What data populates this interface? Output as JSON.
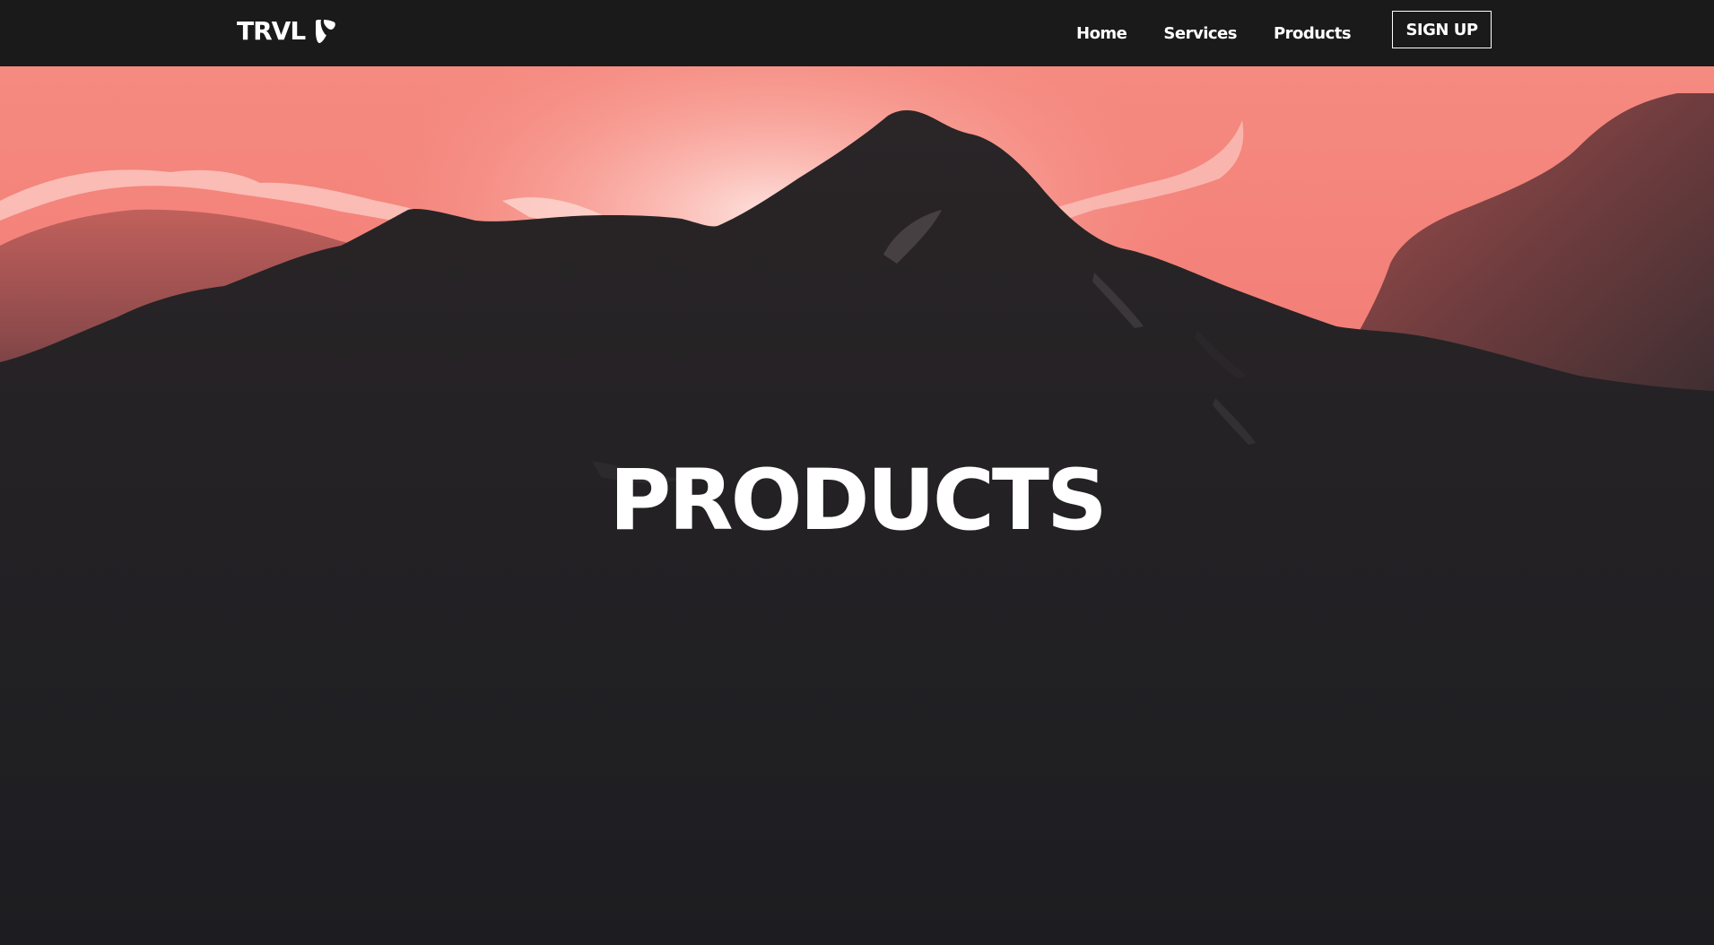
{
  "brand": {
    "name": "TRVL",
    "logo_icon": "typo3-icon"
  },
  "nav": {
    "links": [
      {
        "label": "Home"
      },
      {
        "label": "Services"
      },
      {
        "label": "Products"
      }
    ],
    "signup_label": "SIGN UP"
  },
  "hero": {
    "title": "PRODUCTS",
    "background": "mountain-silhouette-sunset"
  },
  "colors": {
    "navbar": "#1b1a1a",
    "sky": "#f07a72",
    "mountain": "#242226",
    "text": "#ffffff"
  }
}
